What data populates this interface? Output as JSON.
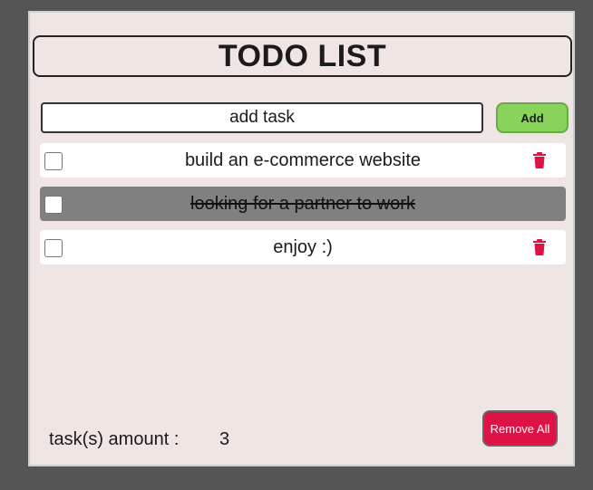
{
  "app": {
    "title": "TODO LIST"
  },
  "input": {
    "placeholder": "add task",
    "value": ""
  },
  "add_button": {
    "label": "Add"
  },
  "tasks": [
    {
      "text": "build an e-commerce website",
      "done": false,
      "checked": false
    },
    {
      "text": "looking for a partner to work",
      "done": true,
      "checked": false
    },
    {
      "text": "enjoy :)",
      "done": false,
      "checked": false
    }
  ],
  "footer": {
    "amount_label": "task(s) amount :",
    "amount_value": "3",
    "remove_all_label": "Remove All"
  },
  "colors": {
    "panel_bg": "#efe5e3",
    "outer_bg": "#555555",
    "add_button": "#88d35a",
    "remove_all_button": "#dd1346",
    "trash_icon": "#dd1346",
    "done_row": "#808080"
  },
  "icons": {
    "delete": "trash-icon"
  }
}
